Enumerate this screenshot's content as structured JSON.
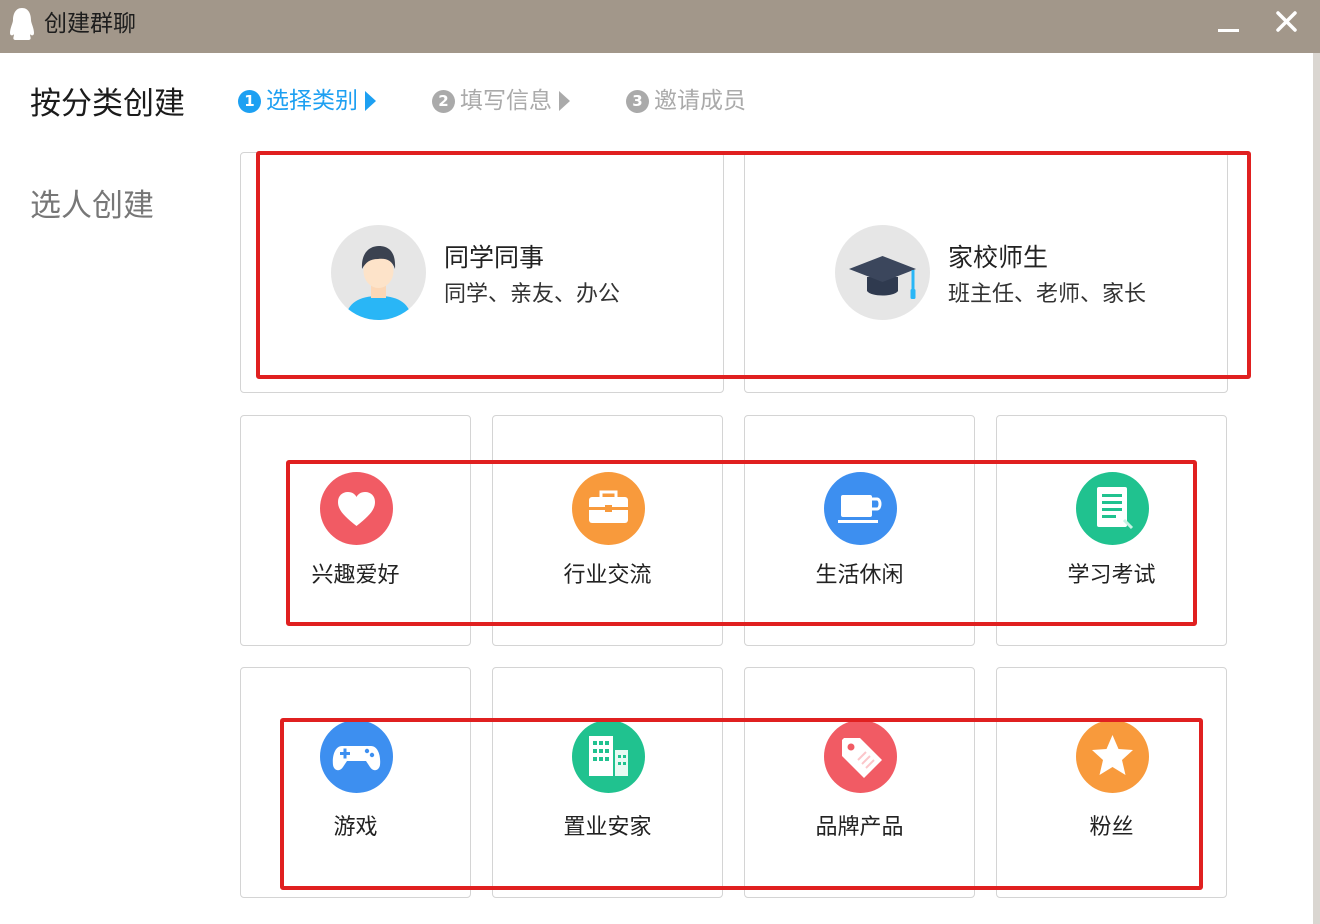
{
  "window": {
    "title": "创建群聊",
    "app_icon": "qq-penguin-icon",
    "minimize_icon": "minimize-icon",
    "close_icon": "close-icon"
  },
  "sidebar": {
    "items": [
      {
        "label": "按分类创建",
        "active": true
      },
      {
        "label": "选人创建",
        "active": false
      }
    ]
  },
  "steps": [
    {
      "number": "1",
      "label": "选择类别",
      "state": "active"
    },
    {
      "number": "2",
      "label": "填写信息",
      "state": "inactive"
    },
    {
      "number": "3",
      "label": "邀请成员",
      "state": "inactive"
    }
  ],
  "categories_large": [
    {
      "title": "同学同事",
      "subtitle": "同学、亲友、办公",
      "icon": "person-avatar-icon"
    },
    {
      "title": "家校师生",
      "subtitle": "班主任、老师、家长",
      "icon": "graduation-cap-icon"
    }
  ],
  "categories_small": [
    {
      "label": "兴趣爱好",
      "icon": "heart-icon",
      "color": "#f15b64"
    },
    {
      "label": "行业交流",
      "icon": "briefcase-icon",
      "color": "#f89a3c"
    },
    {
      "label": "生活休闲",
      "icon": "coffee-cup-icon",
      "color": "#3d8ff0"
    },
    {
      "label": "学习考试",
      "icon": "document-icon",
      "color": "#20c28f"
    },
    {
      "label": "游戏",
      "icon": "gamepad-icon",
      "color": "#3d8ff0"
    },
    {
      "label": "置业安家",
      "icon": "buildings-icon",
      "color": "#20c28f"
    },
    {
      "label": "品牌产品",
      "icon": "price-tag-icon",
      "color": "#f15b64"
    },
    {
      "label": "粉丝",
      "icon": "star-icon",
      "color": "#f89a3c"
    }
  ],
  "colors": {
    "accent": "#1da0f2",
    "titlebar": "#a2978a",
    "annotation_red": "#e02020"
  }
}
